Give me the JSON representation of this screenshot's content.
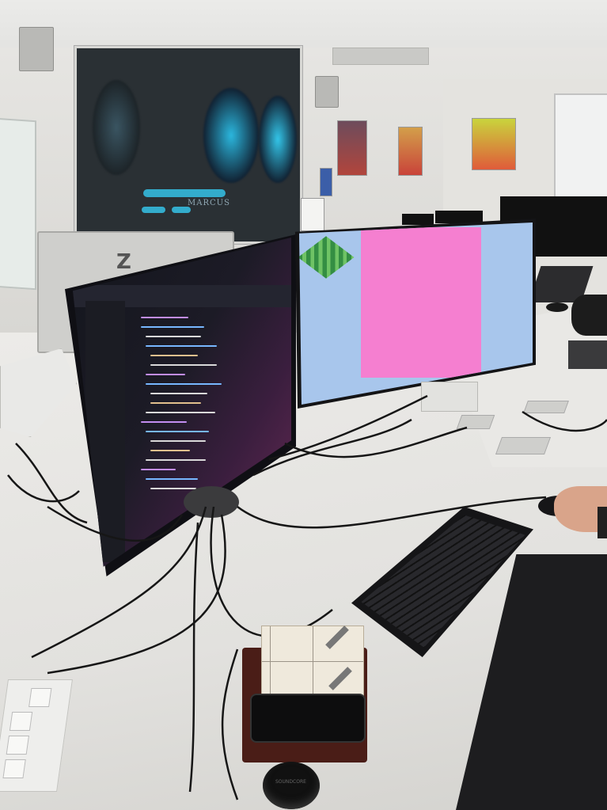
{
  "scene": {
    "location": "computer lab",
    "left_monitor": {
      "content": "code-editor",
      "theme_colors": [
        "#14161d",
        "#6b2a57"
      ]
    },
    "right_monitor": {
      "content": "game-render",
      "background_color": "#a8c6ec",
      "panel_color": "#f57fd0",
      "tile_color": "#2e8b3a"
    },
    "projector_caption": "MARCUS",
    "earbud_case_text": "SOUNDCORE",
    "monitor_brand_mark": "Z"
  }
}
